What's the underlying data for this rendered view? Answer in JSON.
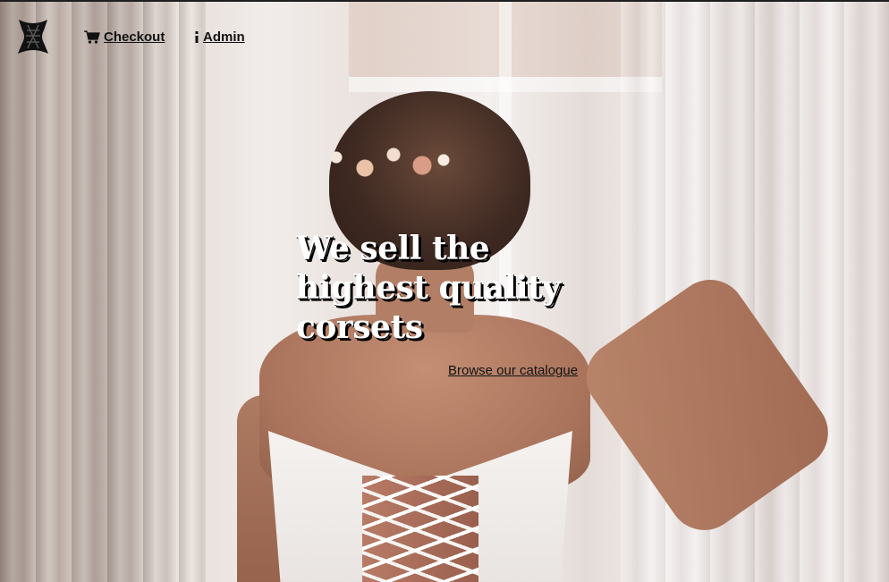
{
  "nav": {
    "logo_icon": "corset-logo-icon",
    "checkout_icon": "cart-icon",
    "checkout_label": "Checkout",
    "admin_icon": "info-icon",
    "admin_label": "Admin"
  },
  "hero": {
    "title": "We sell the highest quality corsets",
    "link_label": "Browse our catalogue"
  },
  "colors": {
    "text": "#111111",
    "title": "#ffffff",
    "title_shadow": "#000000"
  }
}
